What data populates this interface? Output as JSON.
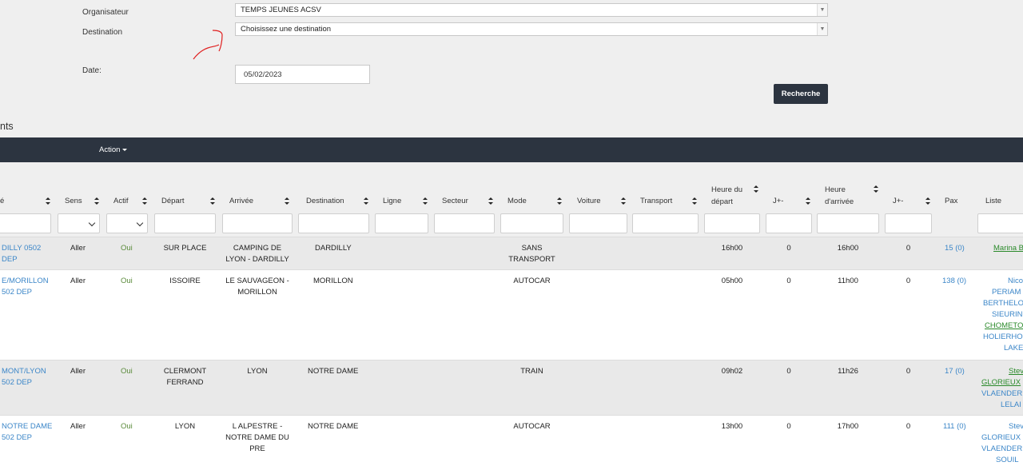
{
  "form": {
    "organisateur_label": "Organisateur",
    "organisateur_value": "TEMPS JEUNES ACSV",
    "destination_label": "Destination",
    "destination_value": "Choisissez une destination",
    "date_label": "Date:",
    "date_value": "05/02/2023",
    "search_label": "Recherche"
  },
  "section_title": "nts",
  "toolbar": {
    "action_label": "Action"
  },
  "columns": {
    "c0": "é",
    "sens": "Sens",
    "actif": "Actif",
    "depart": "Départ",
    "arrivee": "Arrivée",
    "destination": "Destination",
    "ligne": "Ligne",
    "secteur": "Secteur",
    "mode": "Mode",
    "voiture": "Voiture",
    "transport": "Transport",
    "heure_depart_1": "Heure du",
    "heure_depart_2": "départ",
    "jpm1": "J+-",
    "heure_arrivee_1": "Heure",
    "heure_arrivee_2": "d'arrivée",
    "jpm2": "J+-",
    "pax": "Pax",
    "liste": "Liste"
  },
  "rows": [
    {
      "name1": "DILLY 0502",
      "name2": "DEP",
      "sens": "Aller",
      "actif": "Oui",
      "depart1": "SUR PLACE",
      "depart2": "",
      "arrivee1": "CAMPING DE",
      "arrivee2": "LYON - DARDILLY",
      "arrivee3": "",
      "destination": "DARDILLY",
      "mode1": "SANS",
      "mode2": "TRANSPORT",
      "heure_depart": "16h00",
      "jpm1": "0",
      "heure_arrivee": "16h00",
      "jpm2": "0",
      "pax": "15 (0)",
      "liste": [
        "Marina B"
      ]
    },
    {
      "name1": "E/MORILLON",
      "name2": "502 DEP",
      "sens": "Aller",
      "actif": "Oui",
      "depart1": "ISSOIRE",
      "depart2": "",
      "arrivee1": "LE SAUVAGEON -",
      "arrivee2": "MORILLON",
      "arrivee3": "",
      "destination": "MORILLON",
      "mode1": "AUTOCAR",
      "mode2": "",
      "heure_depart": "05h00",
      "jpm1": "0",
      "heure_arrivee": "11h00",
      "jpm2": "0",
      "pax": "138 (0)",
      "liste": [
        "Nico",
        "PERIAM",
        "BERTHELO",
        "SIEURIN",
        "CHOMETO",
        "HOLIERHO",
        "LAKE"
      ]
    },
    {
      "name1": "MONT/LYON",
      "name2": "502 DEP",
      "sens": "Aller",
      "actif": "Oui",
      "depart1": "CLERMONT",
      "depart2": "FERRAND",
      "arrivee1": "LYON",
      "arrivee2": "",
      "arrivee3": "",
      "destination": "NOTRE DAME",
      "mode1": "TRAIN",
      "mode2": "",
      "heure_depart": "09h02",
      "jpm1": "0",
      "heure_arrivee": "11h26",
      "jpm2": "0",
      "pax": "17 (0)",
      "liste": [
        "Stev",
        "GLORIEUX",
        "VLAENDER",
        "LELAI"
      ]
    },
    {
      "name1": "NOTRE DAME",
      "name2": "502 DEP",
      "sens": "Aller",
      "actif": "Oui",
      "depart1": "LYON",
      "depart2": "",
      "arrivee1": "L ALPESTRE -",
      "arrivee2": "NOTRE DAME DU",
      "arrivee3": "PRE",
      "destination": "NOTRE DAME",
      "mode1": "AUTOCAR",
      "mode2": "",
      "heure_depart": "13h00",
      "jpm1": "0",
      "heure_arrivee": "17h00",
      "jpm2": "0",
      "pax": "111 (0)",
      "liste": [
        "Stev",
        "GLORIEUX",
        "VLAENDER",
        "SOUIL"
      ]
    }
  ]
}
